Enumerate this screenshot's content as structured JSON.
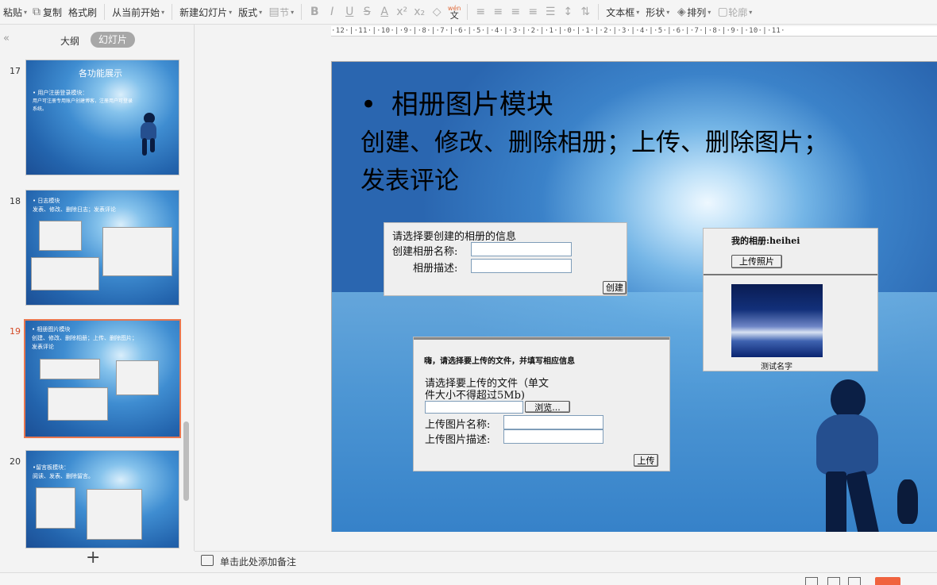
{
  "toolbar": {
    "paste": "粘贴",
    "copy": "复制",
    "format_painter": "格式刷",
    "from_current": "从当前开始",
    "new_slide": "新建幻灯片",
    "layout": "版式",
    "section": "节",
    "text_box": "文本框",
    "shape": "形状",
    "arrange": "排列",
    "outline": "轮廓",
    "font_sub": "wén",
    "font_char": "文"
  },
  "left_panel": {
    "tab_outline": "大纲",
    "tab_slides": "幻灯片",
    "slides": [
      {
        "number": "17",
        "title": "各功能展示",
        "bullet": "• 用户注册登录模块：",
        "text": "用户可注册专用账户创建博客，注册用户可登录系统。"
      },
      {
        "number": "18",
        "line1": "• 日志模块",
        "line2": "发表、修改、删除日志；发表评论"
      },
      {
        "number": "19",
        "line1": "• 相册图片模块",
        "line2": "创建、修改、删除相册；上传、删除图片；",
        "line3": "发表评论"
      },
      {
        "number": "20",
        "line1": "•留言板模块：",
        "line2": "阅读、发表、删除留言。"
      }
    ]
  },
  "ruler": {
    "text": "·12·|·11·|·10·|·9·|·8·|·7·|·6·|·5·|·4·|·3·|·2·|·1·|·0·|·1·|·2·|·3·|·4·|·5·|·6·|·7·|·8·|·9·|·10·|·11·"
  },
  "slide": {
    "bullet": "•",
    "title": "相册图片模块",
    "body_line1": "创建、修改、删除相册；上传、删除图片；",
    "body_line2": "发表评论",
    "create_album": {
      "heading": "请选择要创建的相册的信息",
      "name_label": "创建相册名称:",
      "desc_label": "相册描述:",
      "create_button": "创建"
    },
    "my_album": {
      "title": "我的相册:heihei",
      "upload_button": "上传照片",
      "caption": "测试名字"
    },
    "upload_form": {
      "heading": "嗨，请选择要上传的文件，并填写相应信息",
      "instruction_line1": "请选择要上传的文件（单文",
      "instruction_line2": "件大小不得超过5Mb)",
      "browse_button": "浏览...",
      "pic_name_label": "上传图片名称:",
      "pic_desc_label": "上传图片描述:",
      "upload_button": "上传"
    }
  },
  "notes": {
    "placeholder": "单击此处添加备注"
  }
}
